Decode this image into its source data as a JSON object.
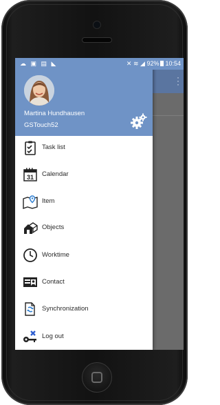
{
  "status_bar": {
    "left_icons": [
      "cloud-icon",
      "gallery-icon",
      "message-icon",
      "signal-icon"
    ],
    "battery_percent": "92%",
    "time": "10:54"
  },
  "drawer": {
    "user_name": "Martina Hundhausen",
    "account": "GSTouch52",
    "items": [
      {
        "label": "Task list",
        "icon": "clipboard-icon"
      },
      {
        "label": "Calendar",
        "icon": "calendar-icon",
        "icon_text": "31"
      },
      {
        "label": "Item",
        "icon": "map-pin-icon"
      },
      {
        "label": "Objects",
        "icon": "objects-icon"
      },
      {
        "label": "Worktime",
        "icon": "clock-icon"
      },
      {
        "label": "Contact",
        "icon": "contact-card-icon"
      },
      {
        "label": "Synchronization",
        "icon": "sync-document-icon"
      },
      {
        "label": "Log out",
        "icon": "key-logout-icon"
      }
    ]
  },
  "colors": {
    "header_blue": "#6f93c6",
    "toolbar_blue": "#5a75a0",
    "scrim": "#6d6d6d",
    "icon_dark": "#222222",
    "icon_blue": "#2f7fd1",
    "logout_x": "#2f5fd0"
  }
}
